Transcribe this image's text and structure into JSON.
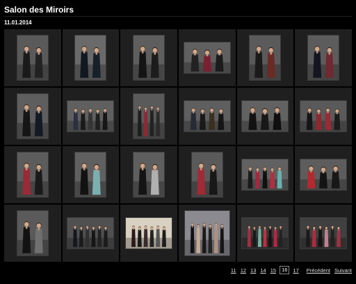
{
  "header": {
    "title": "Salon des Miroirs",
    "date": "11.01.2014"
  },
  "gallery": {
    "photos": [
      {
        "name": "photo-1-1",
        "orient": "portrait",
        "people": 2,
        "bg": "#5a5a5a",
        "colors": [
          "#1a1a1a",
          "#222"
        ]
      },
      {
        "name": "photo-1-2",
        "orient": "portrait",
        "people": 2,
        "bg": "#6a6a6a",
        "colors": [
          "#101820",
          "#15202a"
        ]
      },
      {
        "name": "photo-1-3",
        "orient": "portrait",
        "people": 2,
        "bg": "#5e5e5e",
        "colors": [
          "#141414",
          "#1c1c1c"
        ]
      },
      {
        "name": "photo-1-4",
        "orient": "landscape",
        "people": 3,
        "bg": "#606060",
        "colors": [
          "#222",
          "#7a2030",
          "#1b1b1b"
        ]
      },
      {
        "name": "photo-1-5",
        "orient": "portrait",
        "people": 2,
        "bg": "#5a5a5a",
        "colors": [
          "#1a1a1a",
          "#6a2a25"
        ]
      },
      {
        "name": "photo-1-6",
        "orient": "portrait",
        "people": 2,
        "bg": "#5c5c5c",
        "colors": [
          "#151520",
          "#6e2a30"
        ]
      },
      {
        "name": "photo-2-1",
        "orient": "portrait",
        "people": 2,
        "bg": "#5e5e5e",
        "colors": [
          "#151515",
          "#131a25"
        ]
      },
      {
        "name": "photo-2-2",
        "orient": "landscape",
        "people": 5,
        "bg": "#606060",
        "colors": [
          "#2a3040",
          "#1a1a1a",
          "#353535",
          "#202020",
          "#151515"
        ]
      },
      {
        "name": "photo-2-3",
        "orient": "portrait",
        "people": 4,
        "bg": "#5a5a5a",
        "colors": [
          "#1e1e1e",
          "#8a2a35",
          "#222",
          "#2b2b2b"
        ]
      },
      {
        "name": "photo-2-4",
        "orient": "landscape",
        "people": 4,
        "bg": "#5f5f5f",
        "colors": [
          "#252a35",
          "#1a1a1a",
          "#3a3020",
          "#151515"
        ]
      },
      {
        "name": "photo-2-5",
        "orient": "landscape",
        "people": 3,
        "bg": "#626262",
        "colors": [
          "#121212",
          "#181818",
          "#0f0f0f"
        ]
      },
      {
        "name": "photo-2-6",
        "orient": "landscape",
        "people": 4,
        "bg": "#5a5a5a",
        "colors": [
          "#151515",
          "#8a2a30",
          "#9a2a35",
          "#1c1c1c"
        ]
      },
      {
        "name": "photo-3-1",
        "orient": "portrait",
        "people": 2,
        "bg": "#5c5c5c",
        "colors": [
          "#9a2a35",
          "#1a1a1a"
        ]
      },
      {
        "name": "photo-3-2",
        "orient": "portrait",
        "people": 2,
        "bg": "#606060",
        "colors": [
          "#121212",
          "#7ab0b0"
        ]
      },
      {
        "name": "photo-3-3",
        "orient": "portrait",
        "people": 2,
        "bg": "#5e5e5e",
        "colors": [
          "#141414",
          "#b0b0b0"
        ]
      },
      {
        "name": "photo-3-4",
        "orient": "portrait",
        "people": 2,
        "bg": "#5a5a5a",
        "colors": [
          "#a02a35",
          "#181818"
        ]
      },
      {
        "name": "photo-3-5",
        "orient": "landscape",
        "people": 5,
        "bg": "#616161",
        "colors": [
          "#1a1a1a",
          "#a02a40",
          "#111",
          "#b03040",
          "#6ab0b0"
        ]
      },
      {
        "name": "photo-3-6",
        "orient": "landscape",
        "people": 3,
        "bg": "#5d5d5d",
        "colors": [
          "#b02a30",
          "#141414",
          "#181818"
        ]
      },
      {
        "name": "photo-4-1",
        "orient": "portrait",
        "people": 2,
        "bg": "#5a5a5a",
        "colors": [
          "#121212",
          "#707070"
        ]
      },
      {
        "name": "photo-4-2",
        "orient": "landscape",
        "people": 6,
        "bg": "#505050",
        "colors": [
          "#151520",
          "#1a1a1a",
          "#303030",
          "#151515",
          "#222",
          "#1b1b1b"
        ]
      },
      {
        "name": "photo-4-3",
        "orient": "landscape",
        "people": 6,
        "bg": "#d8d0c0",
        "colors": [
          "#2a1a1a",
          "#1a1a1a",
          "#3a2a2a",
          "#222",
          "#555",
          "#1c1c1c"
        ]
      },
      {
        "name": "photo-4-4",
        "orient": "portrait-wide",
        "people": 6,
        "bg": "#8a8a90",
        "colors": [
          "#111",
          "#c8a890",
          "#1a1a1a",
          "#222",
          "#b09080",
          "#151515"
        ]
      },
      {
        "name": "photo-4-5",
        "orient": "landscape",
        "people": 7,
        "bg": "#3a3a3a",
        "colors": [
          "#a03040",
          "#1a1a1a",
          "#7ab0a0",
          "#c03040",
          "#151515",
          "#b02a45",
          "#222"
        ]
      },
      {
        "name": "photo-4-6",
        "orient": "landscape",
        "people": 6,
        "bg": "#404040",
        "colors": [
          "#1a1a1a",
          "#b02a40",
          "#151515",
          "#c08090",
          "#222",
          "#a03040"
        ]
      }
    ]
  },
  "pagination": {
    "pages": [
      "11",
      "12",
      "13",
      "14",
      "15"
    ],
    "current": "16",
    "after": [
      "17"
    ],
    "prev_label": "Précédent",
    "next_label": "Suivant"
  }
}
